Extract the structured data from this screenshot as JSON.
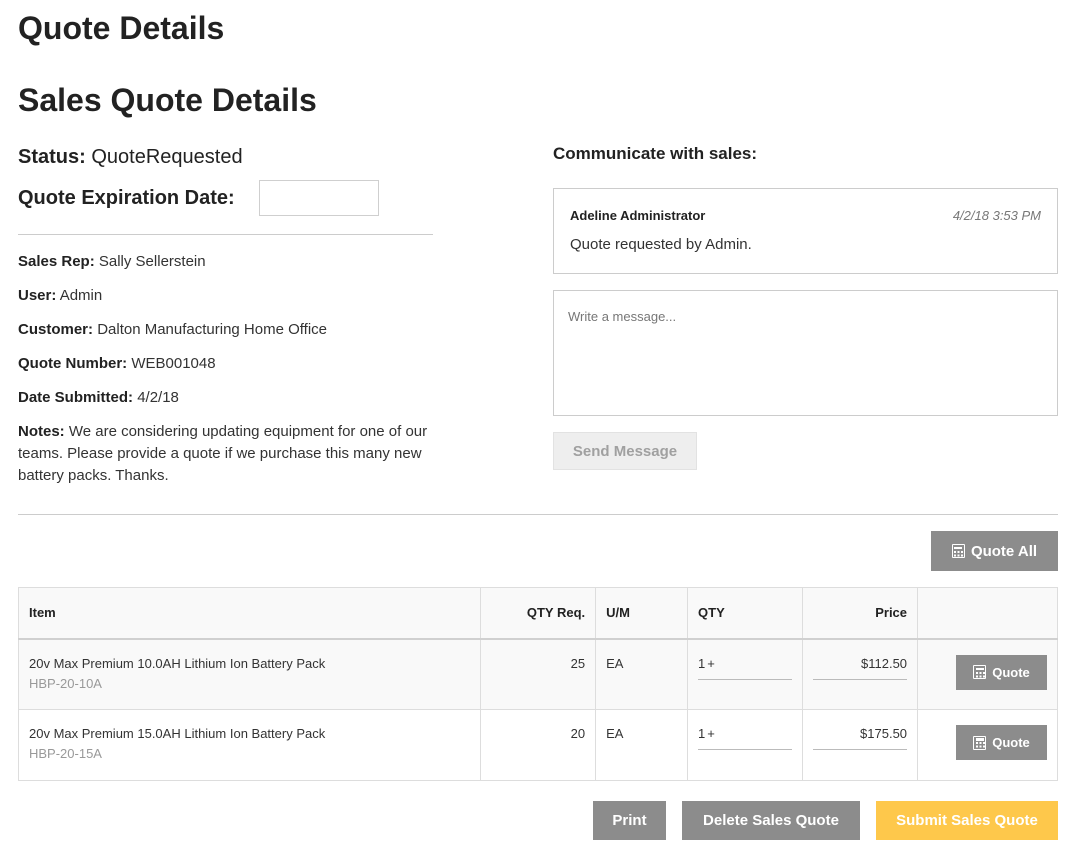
{
  "page": {
    "title": "Quote Details",
    "subtitle": "Sales Quote Details"
  },
  "summary": {
    "status_label": "Status:",
    "status_value": "QuoteRequested",
    "expiration_label": "Quote Expiration Date:",
    "expiration_value": "",
    "sales_rep_label": "Sales Rep:",
    "sales_rep_value": "Sally Sellerstein",
    "user_label": "User:",
    "user_value": "Admin",
    "customer_label": "Customer:",
    "customer_value": "Dalton Manufacturing Home Office",
    "quote_number_label": "Quote Number:",
    "quote_number_value": "WEB001048",
    "date_submitted_label": "Date Submitted:",
    "date_submitted_value": "4/2/18",
    "notes_label": "Notes:",
    "notes_value": "We are considering updating equipment for one of our teams. Please provide a quote if we purchase this many new battery packs. Thanks."
  },
  "communication": {
    "title": "Communicate with sales:",
    "messages": [
      {
        "author": "Adeline Administrator",
        "time": "4/2/18 3:53 PM",
        "text": "Quote requested by Admin."
      }
    ],
    "input_placeholder": "Write a message...",
    "send_label": "Send Message"
  },
  "quote_all_label": "Quote All",
  "table": {
    "headers": {
      "item": "Item",
      "qty_req": "QTY Req.",
      "um": "U/M",
      "qty": "QTY",
      "price": "Price",
      "action": ""
    },
    "rows": [
      {
        "name": "20v Max Premium 10.0AH Lithium Ion Battery Pack",
        "sku": "HBP-20-10A",
        "qty_req": "25",
        "um": "EA",
        "qty": "1",
        "qty_suffix": "+",
        "price": "$112.50",
        "action_label": "Quote"
      },
      {
        "name": "20v Max Premium 15.0AH Lithium Ion Battery Pack",
        "sku": "HBP-20-15A",
        "qty_req": "20",
        "um": "EA",
        "qty": "1",
        "qty_suffix": "+",
        "price": "$175.50",
        "action_label": "Quote"
      }
    ]
  },
  "actions": {
    "print_label": "Print",
    "delete_label": "Delete Sales Quote",
    "submit_label": "Submit Sales Quote"
  },
  "colors": {
    "gray_button": "#8c8c8c",
    "submit_button": "#fec84b",
    "border": "#cccccc"
  },
  "icons": {
    "quote": "calculator-icon"
  }
}
